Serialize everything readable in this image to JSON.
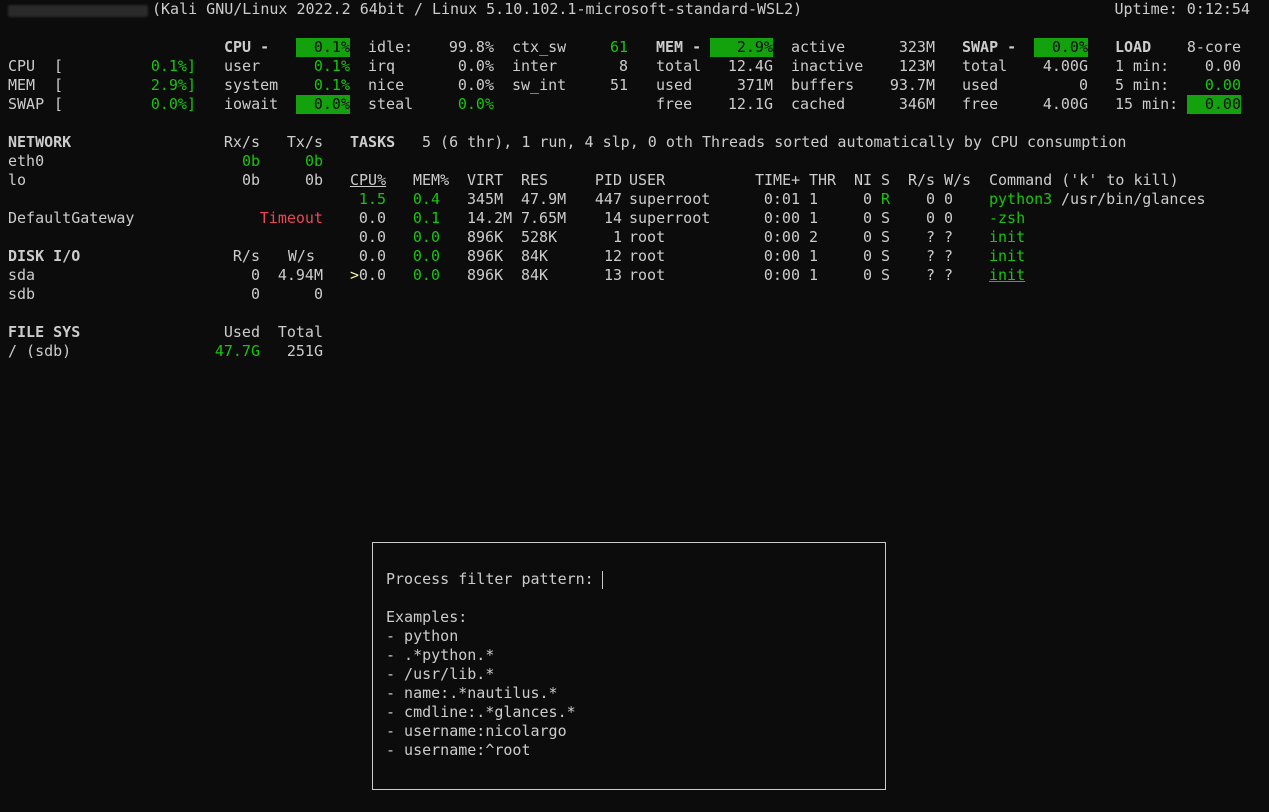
{
  "header": {
    "system": "(Kali GNU/Linux 2022.2 64bit / Linux 5.10.102.1-microsoft-standard-WSL2)",
    "uptime": "Uptime: 0:12:54"
  },
  "quicklook": {
    "rows": [
      {
        "label": "CPU",
        "value": "0.1%]"
      },
      {
        "label": "MEM",
        "value": "2.9%]"
      },
      {
        "label": "SWAP",
        "value": "0.0%]"
      }
    ]
  },
  "cpu": {
    "title": "CPU -",
    "total": "0.1%",
    "rows": [
      {
        "l": "user",
        "v": "0.1%"
      },
      {
        "l": "system",
        "v": "0.1%"
      },
      {
        "l": "iowait",
        "v": "0.0%"
      }
    ],
    "col2": [
      {
        "l": "idle:",
        "v": "99.8%"
      },
      {
        "l": "irq",
        "v": "0.0%"
      },
      {
        "l": "nice",
        "v": "0.0%"
      },
      {
        "l": "steal",
        "v": "0.0%"
      }
    ],
    "col3": [
      {
        "l": "ctx_sw",
        "v": "61"
      },
      {
        "l": "inter",
        "v": "8"
      },
      {
        "l": "sw_int",
        "v": "51"
      }
    ]
  },
  "mem": {
    "title": "MEM -",
    "total_pct": "2.9%",
    "col1": [
      {
        "l": "total",
        "v": "12.4G"
      },
      {
        "l": "used",
        "v": "371M"
      },
      {
        "l": "free",
        "v": "12.1G"
      }
    ],
    "col2": [
      {
        "l": "active",
        "v": "323M"
      },
      {
        "l": "inactive",
        "v": "123M"
      },
      {
        "l": "buffers",
        "v": "93.7M"
      },
      {
        "l": "cached",
        "v": "346M"
      }
    ]
  },
  "swap": {
    "title": "SWAP -",
    "pct": "0.0%",
    "rows": [
      {
        "l": "total",
        "v": "4.00G"
      },
      {
        "l": "used",
        "v": "0"
      },
      {
        "l": "free",
        "v": "4.00G"
      }
    ]
  },
  "load": {
    "title": "LOAD",
    "cores": "8-core",
    "rows": [
      {
        "l": "1 min:",
        "v": "0.00"
      },
      {
        "l": "5 min:",
        "v": "0.00"
      },
      {
        "l": "15 min:",
        "v": "0.00"
      }
    ]
  },
  "network": {
    "title": "NETWORK",
    "rx": "Rx/s",
    "tx": "Tx/s",
    "rows": [
      {
        "iface": "eth0",
        "rx": "0b",
        "tx": "0b"
      },
      {
        "iface": "lo",
        "rx": "0b",
        "tx": "0b"
      }
    ]
  },
  "gateway": {
    "label": "DefaultGateway",
    "status": "Timeout"
  },
  "disk": {
    "title": "DISK I/O",
    "r": "R/s",
    "w": "W/s",
    "rows": [
      {
        "name": "sda",
        "r": "0",
        "w": "4.94M"
      },
      {
        "name": "sdb",
        "r": "0",
        "w": "0"
      }
    ]
  },
  "fs": {
    "title": "FILE SYS",
    "used_h": "Used",
    "total_h": "Total",
    "rows": [
      {
        "name": "/ (sdb)",
        "used": "47.7G",
        "total": "251G"
      }
    ]
  },
  "tasks": {
    "title": "TASKS",
    "summary": "5 (6 thr), 1 run, 4 slp, 0 oth Threads sorted automatically by CPU consumption"
  },
  "process_table": {
    "headers": {
      "cpu": "CPU%",
      "mem": "MEM%",
      "virt": "VIRT",
      "res": "RES",
      "pid": "PID",
      "user": "USER",
      "time": "TIME+",
      "thr": "THR",
      "ni": "NI",
      "s": "S",
      "rs": "R/s",
      "ws": "W/s",
      "cmd": "Command ('k' to kill)"
    },
    "rows": [
      {
        "cpu": "1.5",
        "mem": "0.4",
        "virt": "345M",
        "res": "47.9M",
        "pid": "447",
        "user": "superroot",
        "time": "0:01",
        "thr": "1",
        "ni": "0",
        "s": "R",
        "rs": "0",
        "ws": "0",
        "cmd": "python3",
        "args": "/usr/bin/glances"
      },
      {
        "cpu": "0.0",
        "mem": "0.1",
        "virt": "14.2M",
        "res": "7.65M",
        "pid": "14",
        "user": "superroot",
        "time": "0:00",
        "thr": "1",
        "ni": "0",
        "s": "S",
        "rs": "0",
        "ws": "0",
        "cmd": "-zsh",
        "args": ""
      },
      {
        "cpu": "0.0",
        "mem": "0.0",
        "virt": "896K",
        "res": "528K",
        "pid": "1",
        "user": "root",
        "time": "0:00",
        "thr": "2",
        "ni": "0",
        "s": "S",
        "rs": "?",
        "ws": "?",
        "cmd": "init",
        "args": ""
      },
      {
        "cpu": "0.0",
        "mem": "0.0",
        "virt": "896K",
        "res": "84K",
        "pid": "12",
        "user": "root",
        "time": "0:00",
        "thr": "1",
        "ni": "0",
        "s": "S",
        "rs": "?",
        "ws": "?",
        "cmd": "init",
        "args": ""
      },
      {
        "cpu": "0.0",
        "mem": "0.0",
        "virt": "896K",
        "res": "84K",
        "pid": "13",
        "user": "root",
        "time": "0:00",
        "thr": "1",
        "ni": "0",
        "s": "S",
        "rs": "?",
        "ws": "?",
        "cmd": "init",
        "args": ""
      }
    ],
    "selected_marker": ">"
  },
  "filter_popup": {
    "prompt": "Process filter pattern:",
    "examples_title": "Examples:",
    "examples": [
      "- python",
      "- .*python.*",
      "- /usr/lib.*",
      "- name:.*nautilus.*",
      "- cmdline:.*glances.*",
      "- username:nicolargo",
      "- username:^root"
    ]
  }
}
